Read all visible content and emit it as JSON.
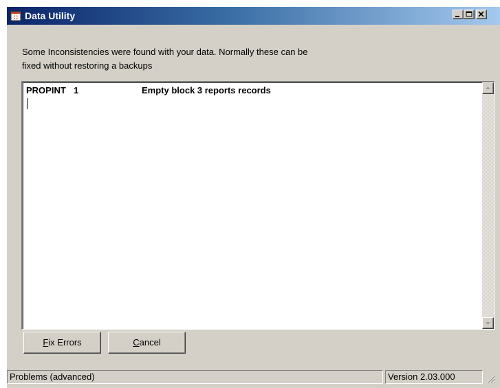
{
  "window": {
    "title": "Data Utility",
    "controls": {
      "minimize_icon": "minimize-icon",
      "maximize_icon": "maximize-icon",
      "close_icon": "close-icon"
    }
  },
  "message": {
    "line1": "Some Inconsistencies were found with your data.  Normally these can be",
    "line2": "fixed without restoring a backups"
  },
  "results": {
    "rows": [
      {
        "code": "PROPINT",
        "count": "1",
        "description": "Empty block 3 reports records"
      }
    ]
  },
  "buttons": {
    "fix_errors": {
      "mnemonic": "F",
      "rest": "ix Errors"
    },
    "cancel": {
      "mnemonic": "C",
      "rest": "ancel"
    }
  },
  "status": {
    "left": "Problems (advanced)",
    "right": "Version 2.03.000"
  },
  "colors": {
    "titlebar_start": "#0a246a",
    "titlebar_end": "#a6caf0",
    "face": "#d4d0c8"
  }
}
